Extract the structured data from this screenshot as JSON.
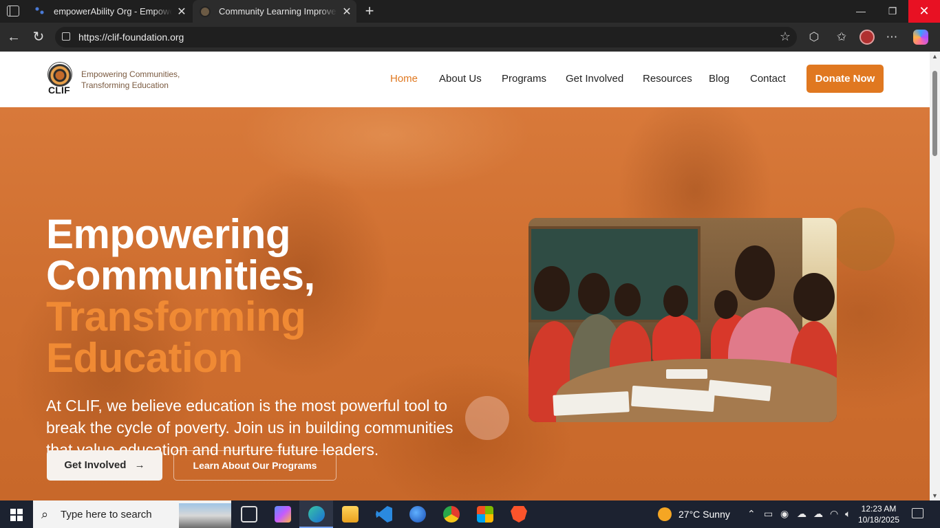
{
  "browser": {
    "tabs": [
      {
        "title": "empowerAbility Org - Empower th",
        "active": false
      },
      {
        "title": "Community Learning Improvemen",
        "active": true
      }
    ],
    "url": "https://clif-foundation.org"
  },
  "site": {
    "logo_text": "CLIF",
    "tagline_line1": "Empowering Communities,",
    "tagline_line2": "Transforming Education",
    "nav": [
      "Home",
      "About Us",
      "Programs",
      "Get Involved",
      "Resources",
      "Blog",
      "Contact"
    ],
    "nav_active": "Home",
    "donate_label": "Donate Now",
    "accent_color": "#e07820"
  },
  "hero": {
    "title_line1": "Empowering",
    "title_line2": "Communities,",
    "title_line3": "Transforming",
    "title_line4": "Education",
    "description": "At CLIF, we believe education is the most powerful tool to break the cycle of poverty. Join us in building communities that value education and nurture future leaders.",
    "primary_cta": "Get Involved",
    "secondary_cta": "Learn About Our Programs"
  },
  "taskbar": {
    "search_placeholder": "Type here to search",
    "weather": "27°C  Sunny",
    "time": "12:23 AM",
    "date": "10/18/2025"
  }
}
